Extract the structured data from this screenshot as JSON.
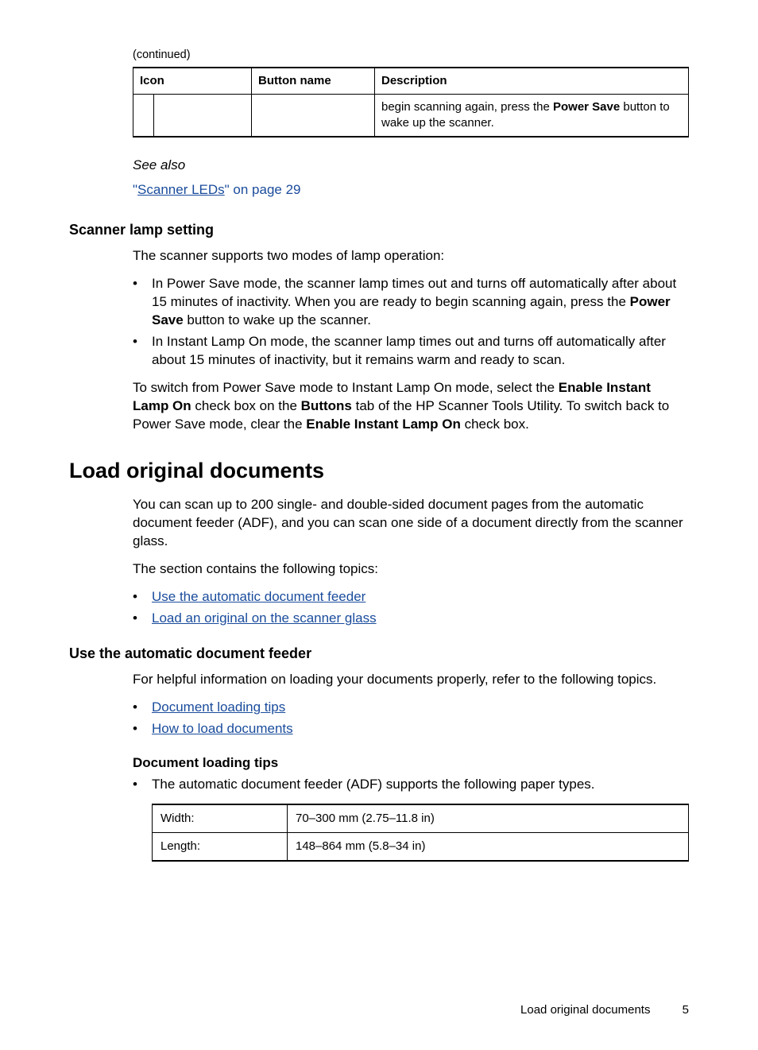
{
  "continued": "(continued)",
  "topTable": {
    "headers": [
      "Icon",
      "Button name",
      "Description"
    ],
    "row": {
      "icon": "",
      "buttonName": "",
      "descPre": "begin scanning again, press the ",
      "descBold": "Power Save",
      "descPost": " button to wake up the scanner."
    }
  },
  "seeAlso": "See also",
  "seeAlsoLinkPre": "\"",
  "seeAlsoLinkText": "Scanner LEDs",
  "seeAlsoLinkPost": "\" on page 29",
  "h2a": "Scanner lamp setting",
  "p1": "The scanner supports two modes of lamp operation:",
  "bullets1": [
    {
      "parts": [
        {
          "t": "In Power Save mode, the scanner lamp times out and turns off automatically after about 15 minutes of inactivity. When you are ready to begin scanning again, press the "
        },
        {
          "b": "Power Save"
        },
        {
          "t": " button to wake up the scanner."
        }
      ]
    },
    {
      "parts": [
        {
          "t": "In Instant Lamp On mode, the scanner lamp times out and turns off automatically after about 15 minutes of inactivity, but it remains warm and ready to scan."
        }
      ]
    }
  ],
  "p2parts": [
    {
      "t": "To switch from Power Save mode to Instant Lamp On mode, select the "
    },
    {
      "b": "Enable Instant Lamp On"
    },
    {
      "t": " check box on the "
    },
    {
      "b": "Buttons"
    },
    {
      "t": " tab of the HP Scanner Tools Utility. To switch back to Power Save mode, clear the "
    },
    {
      "b": "Enable Instant Lamp On"
    },
    {
      "t": " check box."
    }
  ],
  "h1": "Load original documents",
  "p3": "You can scan up to 200 single- and double-sided document pages from the automatic document feeder (ADF), and you can scan one side of a document directly from the scanner glass.",
  "p4": "The section contains the following topics:",
  "bullets2": [
    "Use the automatic document feeder",
    "Load an original on the scanner glass"
  ],
  "h2b": "Use the automatic document feeder",
  "p5": "For helpful information on loading your documents properly, refer to the following topics.",
  "bullets3": [
    "Document loading tips",
    "How to load documents"
  ],
  "h3a": "Document loading tips",
  "bullets4": [
    "The automatic document feeder (ADF) supports the following paper types."
  ],
  "sizeTable": [
    {
      "label": "Width:",
      "value": "70–300 mm (2.75–11.8 in)"
    },
    {
      "label": "Length:",
      "value": "148–864 mm (5.8–34 in)"
    }
  ],
  "footerText": "Load original documents",
  "pageNum": "5"
}
